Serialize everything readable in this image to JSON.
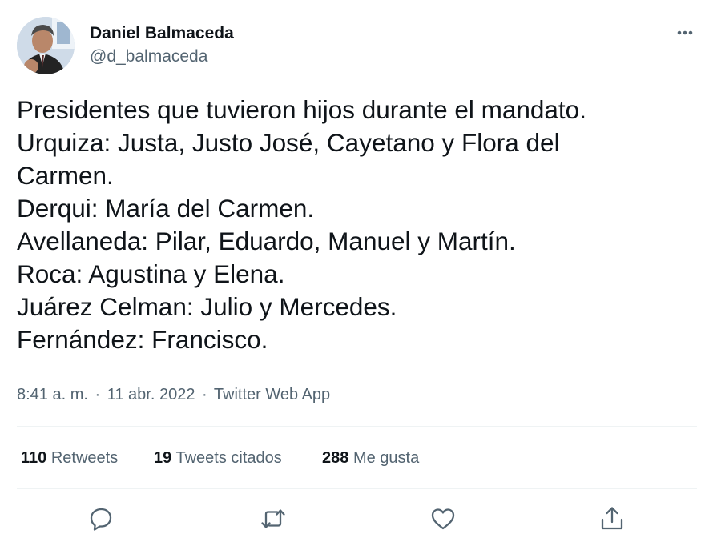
{
  "author": {
    "display_name": "Daniel Balmaceda",
    "handle": "@d_balmaceda"
  },
  "tweet": {
    "lines": [
      "Presidentes que tuvieron hijos durante el mandato.",
      "Urquiza: Justa, Justo José, Cayetano y Flora del",
      "Carmen.",
      "Derqui: María del Carmen.",
      "Avellaneda: Pilar, Eduardo, Manuel y Martín.",
      "Roca: Agustina y Elena.",
      "Juárez Celman: Julio y Mercedes.",
      "Fernández: Francisco."
    ],
    "time": "8:41 a. m.",
    "separator": "·",
    "date": "11 abr. 2022",
    "source": "Twitter Web App"
  },
  "stats": {
    "retweets": {
      "count": "110",
      "label": "Retweets"
    },
    "quotes": {
      "count": "19",
      "label": "Tweets citados"
    },
    "likes": {
      "count": "288",
      "label": "Me gusta"
    }
  },
  "actions": [
    "reply-icon",
    "retweet-icon",
    "like-icon",
    "share-icon"
  ],
  "colors": {
    "text": "#0f1419",
    "secondary": "#536471",
    "divider": "#eff3f4"
  }
}
